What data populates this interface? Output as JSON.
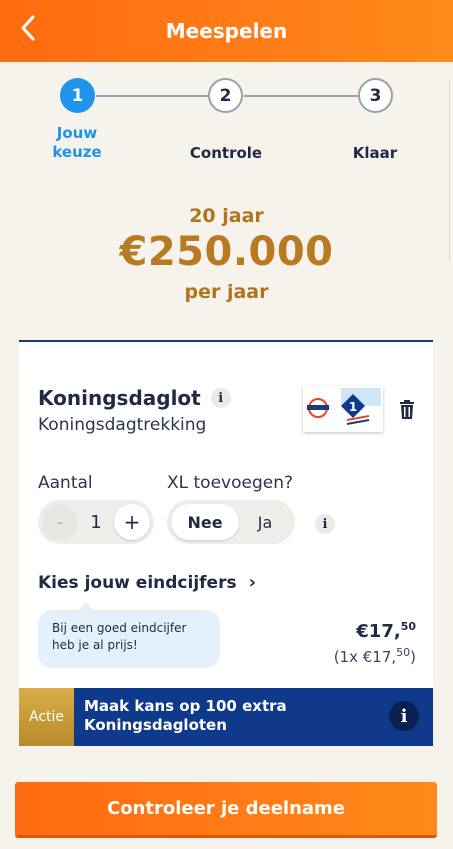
{
  "header": {
    "title": "Meespelen"
  },
  "steps": [
    {
      "number": "1",
      "label_line1": "Jouw",
      "label_line2": "keuze"
    },
    {
      "number": "2",
      "label": "Controle"
    },
    {
      "number": "3",
      "label": "Klaar"
    }
  ],
  "prize": {
    "years": "20 jaar",
    "amount": "€250.000",
    "per": "per jaar"
  },
  "product": {
    "title": "Koningsdaglot",
    "info": "i",
    "subtitle": "Koningsdagtrekking",
    "ticket_badge": "1"
  },
  "options": {
    "aantal_label": "Aantal",
    "xl_label": "XL toevoegen?",
    "minus": "-",
    "quantity": "1",
    "plus": "+",
    "nee": "Nee",
    "ja": "Ja",
    "info": "i"
  },
  "endcijfers": {
    "label": "Kies jouw eindcijfers",
    "chevron": "›",
    "bubble": "Bij een goed eindcijfer heb je al prijs!"
  },
  "price": {
    "main": "€17,",
    "main_cents": "50",
    "sub": "(1x €17,",
    "sub_cents": "50",
    "sub_close": ")"
  },
  "actie": {
    "badge": "Actie",
    "text": "Maak kans op 100 extra Koningsdagloten",
    "info": "i"
  },
  "cta": {
    "label": "Controleer je deelname"
  },
  "colors": {
    "orange": "#ff7a14",
    "blue": "#1f94ea",
    "navy": "#0f3a8c",
    "gold": "#b0761e"
  },
  "icons": {
    "back": "chevron-left-icon",
    "info": "info-icon",
    "trash": "trash-icon"
  }
}
